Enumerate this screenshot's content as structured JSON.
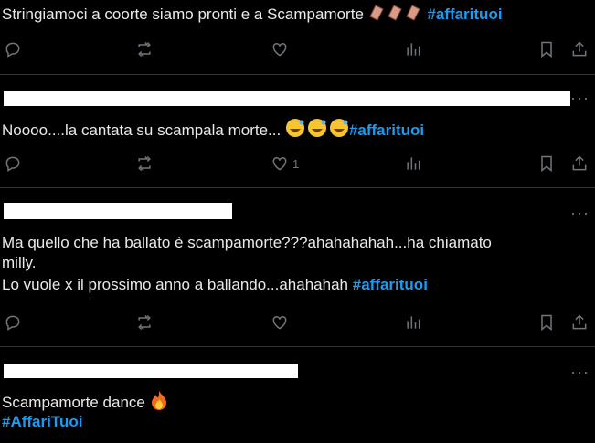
{
  "posts": [
    {
      "text": "Stringiamoci a coorte siamo pronti e a Scampamorte",
      "emoji": "coffin x3",
      "hashtag": "#affarituoi",
      "likes": ""
    },
    {
      "text": "Noooo....la cantata su scampala morte...",
      "emoji": "sweat-smile x3",
      "hashtag": "#affarituoi",
      "likes": "1"
    },
    {
      "line1": "Ma quello che ha ballato è scampamorte???ahahahahah...ha chiamato",
      "line2": "milly.",
      "line3": "Lo vuole x il prossimo anno a ballando...ahahahah",
      "hashtag": "#affarituoi",
      "likes": ""
    },
    {
      "line1": "Scampamorte dance",
      "emoji": "fire",
      "hashtag": "#AffariTuoi"
    }
  ],
  "icons": [
    "reply-icon",
    "retweet-icon",
    "like-icon",
    "views-icon",
    "bookmark-icon",
    "share-icon",
    "more-icon"
  ],
  "colors": {
    "accent": "#1d9bf0",
    "muted": "#71767b",
    "text": "#e7e9ea",
    "divider": "#2f3336",
    "background": "#000000"
  }
}
